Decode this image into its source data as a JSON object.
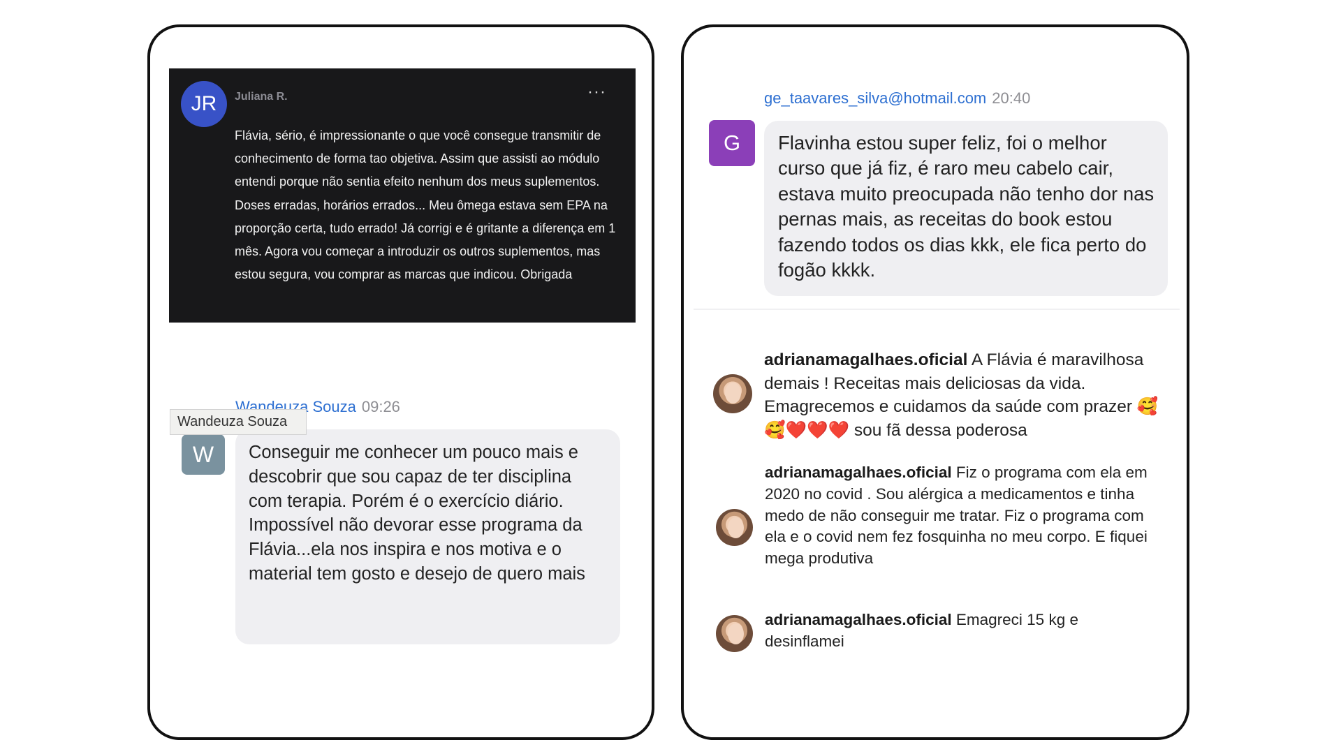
{
  "left_card": {
    "dark_comment": {
      "avatar_initials": "JR",
      "author": "Juliana R.",
      "more_label": "···",
      "text": "Flávia, sério, é impressionante o que você consegue transmitir de conhecimento de forma tao objetiva. Assim que assisti ao módulo entendi porque não sentia efeito nenhum dos meus suplementos. Doses erradas, horários errados... Meu ômega estava sem EPA na proporção certa, tudo errado! Já corrigi e é gritante a diferença em 1 mês. Agora vou começar a introduzir os outros suplementos, mas estou segura, vou comprar as marcas que indicou. Obrigada"
    },
    "chat_message": {
      "sender": "Wandeuza Souza",
      "time": "09:26",
      "tooltip": "Wandeuza Souza",
      "avatar_initial": "W",
      "paragraph_1": "Conseguir me conhecer um pouco mais e descobrir que sou capaz de ter disciplina com terapia. Porém é o exercício diário.",
      "paragraph_2": "Impossível não devorar esse programa da Flávia...ela nos inspira e nos motiva e o material tem gosto e desejo de quero mais"
    }
  },
  "right_card": {
    "email_message": {
      "sender": "ge_taavares_silva@hotmail.com",
      "time": "20:40",
      "avatar_initial": "G",
      "text": "Flavinha estou super feliz, foi o melhor curso que já fiz, é raro meu cabelo cair, estava muito preocupada não tenho dor nas pernas mais, as receitas do book estou fazendo todos os dias kkk, ele fica perto do fogão kkkk."
    },
    "comments": [
      {
        "username": "adrianamagalhaes.oficial",
        "text": "A Flávia é maravilhosa demais ! Receitas mais deliciosas da vida. Emagrecemos e cuidamos da saúde com prazer 🥰🥰❤️❤️❤️ sou fã dessa poderosa"
      },
      {
        "username": "adrianamagalhaes.oficial",
        "text": "Fiz o programa com ela em 2020 no covid . Sou alérgica a medicamentos e tinha medo de não conseguir me tratar. Fiz o programa com ela e o covid nem fez fosquinha no meu corpo. E fiquei mega produtiva"
      },
      {
        "username": "adrianamagalhaes.oficial",
        "text": "Emagreci 15 kg e desinflamei"
      }
    ]
  },
  "colors": {
    "link_blue": "#2d6fd1",
    "jr_avatar": "#3852c7",
    "w_avatar": "#7a929f",
    "g_avatar": "#8b3fb8",
    "bubble_bg": "#efeff2",
    "dark_bg": "#18181a"
  }
}
